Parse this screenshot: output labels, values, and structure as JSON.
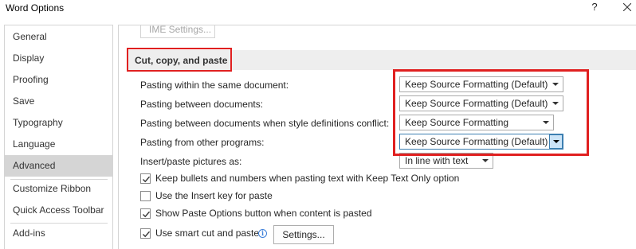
{
  "window": {
    "title": "Word Options",
    "help": "?"
  },
  "sidebar": {
    "items": [
      {
        "label": "General"
      },
      {
        "label": "Display"
      },
      {
        "label": "Proofing"
      },
      {
        "label": "Save"
      },
      {
        "label": "Typography"
      },
      {
        "label": "Language"
      },
      {
        "label": "Advanced",
        "selected": true
      },
      {
        "label": "Customize Ribbon"
      },
      {
        "label": "Quick Access Toolbar"
      },
      {
        "label": "Add-ins"
      }
    ]
  },
  "main": {
    "ime_button": "IME Settings...",
    "section_title": "Cut, copy, and paste",
    "paste_rows": [
      {
        "label": "Pasting within the same document:",
        "value": "Keep Source Formatting (Default)"
      },
      {
        "label": "Pasting between documents:",
        "value": "Keep Source Formatting (Default)"
      },
      {
        "label": "Pasting between documents when style definitions conflict:",
        "value": "Keep Source Formatting"
      },
      {
        "label": "Pasting from other programs:",
        "value": "Keep Source Formatting (Default)"
      }
    ],
    "insert_pictures": {
      "label": "Insert/paste pictures as:",
      "value": "In line with text"
    },
    "checkboxes": [
      {
        "label": "Keep bullets and numbers when pasting text with Keep Text Only option",
        "checked": true
      },
      {
        "label": "Use the Insert key for paste",
        "checked": false
      },
      {
        "label": "Show Paste Options button when content is pasted",
        "checked": true
      },
      {
        "label": "Use smart cut and paste",
        "checked": true
      }
    ],
    "settings_button": "Settings..."
  },
  "colors": {
    "highlight": "#e02020",
    "selected_nav": "#d5d5d5",
    "section_bg": "#eeeeee"
  }
}
